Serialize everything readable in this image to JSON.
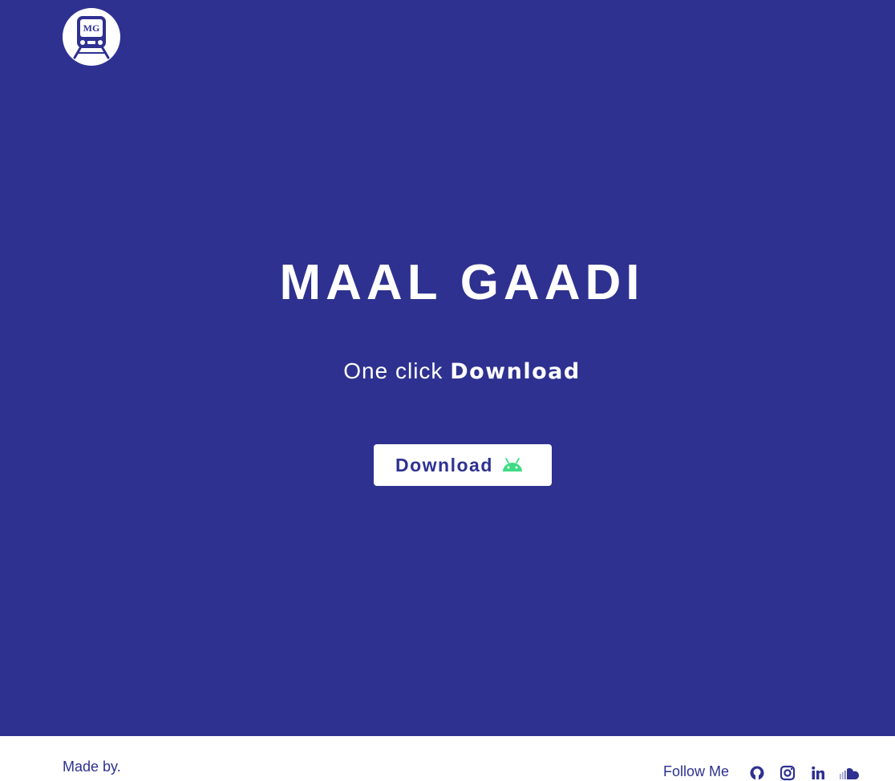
{
  "header": {
    "logo_text": "MG"
  },
  "hero": {
    "title": "MAAL GAADI",
    "tagline_prefix": "One click ",
    "tagline_emphasis": "Download",
    "download_button_label": "Download",
    "download_button_icon": "android-icon"
  },
  "footer": {
    "made_by": "Made by.",
    "follow_label": "Follow Me",
    "social_icons": [
      "github-icon",
      "instagram-icon",
      "linkedin-icon",
      "soundcloud-icon"
    ]
  },
  "colors": {
    "background": "#2e3190",
    "text_primary": "#ffffff",
    "button_bg": "#ffffff",
    "button_text": "#2e3190",
    "android_green": "#3ddc84",
    "footer_bg": "#ffffff"
  }
}
